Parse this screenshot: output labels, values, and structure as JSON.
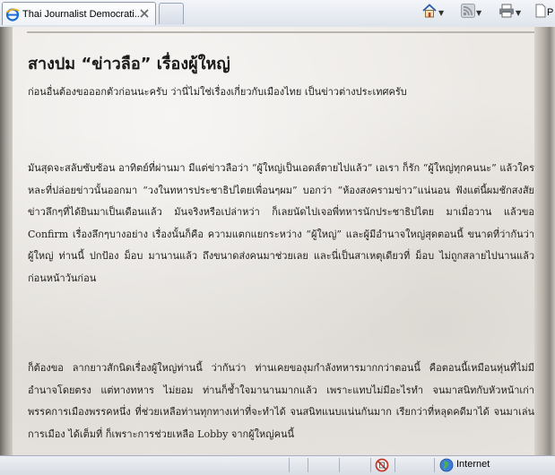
{
  "browser": {
    "tab_title": "Thai Journalist Democrati...",
    "toolbar": {
      "home_icon": "home-icon",
      "feeds_icon": "rss-feed-icon",
      "print_icon": "print-icon",
      "page_label_partial": "P"
    }
  },
  "article": {
    "headline": "สางปม “ข่าวลือ” เรื่องผู้ใหญ่",
    "intro": "ก่อนอื่นต้องขอออกตัวก่อนนะครับ ว่านี่ไม่ใช่เรื่องเกี่ยวกับเมืองไทย เป็นข่าวต่างประเทศครับ",
    "paragraphs": [
      "มันสุดจะสลับซับซ้อน อาทิตย์ที่ผ่านมา มีแต่ข่าวลือว่า “ผู้ใหญ่เป็นเอดส์ตายไปแล้ว” เอเรา ก็รัก “ผู้ใหญ่ทุกคนนะ” แล้วใครหละที่ปล่อยข่าวนั้นออกมา “วงในทหารประชาธิปไตยเพื่อนๆผม” บอกว่า “ห้องสงครามข่าว”แน่นอน ฟังแต่นี้ผมชักสงสัย ข่าวลึกๆที่ได้ยินมาเป็นเดือนแล้ว มันจริงหรือเปล่าหว่า ก็เลยนัดไปเจอพี่ทหารนักประชาธิปไตย มาเมื่อวาน แล้วขอ Confirm เรื่องลึกๆบางอย่าง เรื่องนั้นก็คือ ความแตกแยกระหว่าง “ผู้ใหญ่” และผู้มีอำนาจใหญ่สุดตอนนี้ ขนาดที่ว่ากันว่า ผู้ใหญ่ ท่านนี้ ปกป้อง ม็อบ มานานแล้ว ถึงขนาดส่งคนมาช่วยเลย และนี่เป็นสาเหตุเดียวที่ ม็อบ ไม่ถูกสลายไปนานแล้ว ก่อนหน้าวันก่อน",
      "ก็ต้องขอ ลากยาวสักนิดเรื่องผู้ใหญ่ท่านนี้ ว่ากันว่า ท่านเคยของุมกำลังทหารมากกว่าตอนนี้ คือตอนนี้เหมือนหุ่นที่ไม่มีอำนาจโดยตรง แต่ทางทหาร ไม่ยอม ท่านก็ช้ำใจมานานมากแล้ว เพราะแทบไม่มีอะไรทำ จนมาสนิทกับหัวหน้าเก่า พรรคการเมืองพรรคหนึ่ง ที่ช่วยเหลือท่านทุกทางเท่าที่จะทำได้ จนสนิทแนบแน่นกันมาก เรียกว่าที่หลุดคดีมาได้ จนมาเล่นการเมือง ได้เต็มที่ ก็เพราะการช่วยเหลือ Lobby จากผู้ใหญ่คนนี้"
    ]
  },
  "statusbar": {
    "zone_label": "Internet"
  },
  "colors": {
    "page_text": "#1f1d1a",
    "headline_text": "#1a1a1a",
    "parchment": "#ece9e5",
    "chrome": "#dfe4ec"
  }
}
